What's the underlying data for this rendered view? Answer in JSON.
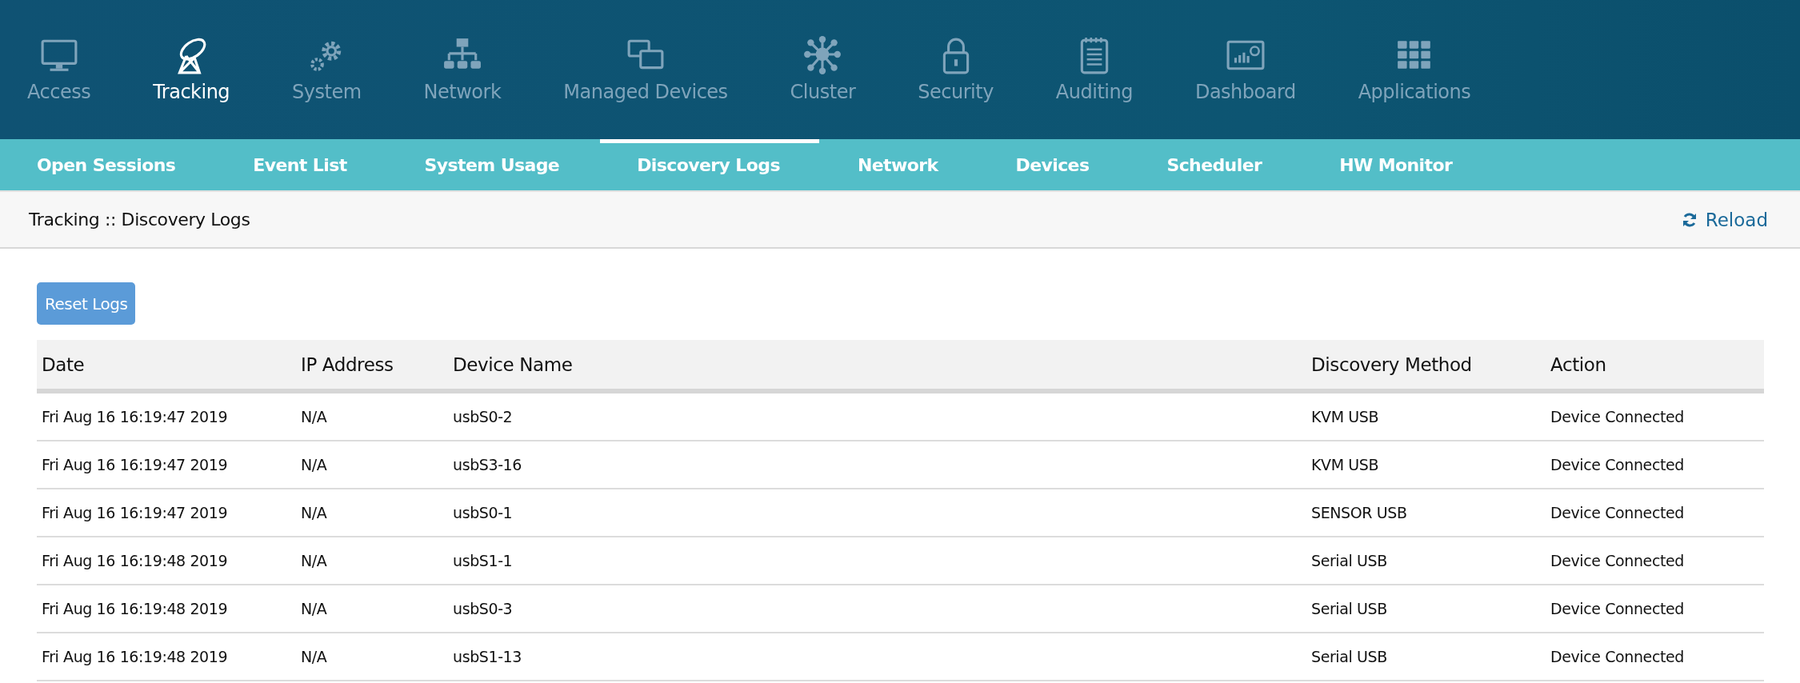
{
  "main_nav": [
    {
      "label": "Access",
      "selected": false
    },
    {
      "label": "Tracking",
      "selected": true
    },
    {
      "label": "System",
      "selected": false
    },
    {
      "label": "Network",
      "selected": false
    },
    {
      "label": "Managed Devices",
      "selected": false
    },
    {
      "label": "Cluster",
      "selected": false
    },
    {
      "label": "Security",
      "selected": false
    },
    {
      "label": "Auditing",
      "selected": false
    },
    {
      "label": "Dashboard",
      "selected": false
    },
    {
      "label": "Applications",
      "selected": false
    }
  ],
  "sub_tabs": [
    {
      "label": "Open Sessions",
      "selected": false
    },
    {
      "label": "Event List",
      "selected": false
    },
    {
      "label": "System Usage",
      "selected": false
    },
    {
      "label": "Discovery Logs",
      "selected": true
    },
    {
      "label": "Network",
      "selected": false
    },
    {
      "label": "Devices",
      "selected": false
    },
    {
      "label": "Scheduler",
      "selected": false
    },
    {
      "label": "HW Monitor",
      "selected": false
    }
  ],
  "breadcrumb": "Tracking :: Discovery Logs",
  "reload_label": "Reload",
  "reset_button": "Reset Logs",
  "table": {
    "columns": [
      "Date",
      "IP Address",
      "Device Name",
      "Discovery Method",
      "Action"
    ],
    "rows": [
      [
        "Fri Aug 16 16:19:47 2019",
        "N/A",
        "usbS0-2",
        "KVM USB",
        "Device Connected"
      ],
      [
        "Fri Aug 16 16:19:47 2019",
        "N/A",
        "usbS3-16",
        "KVM USB",
        "Device Connected"
      ],
      [
        "Fri Aug 16 16:19:47 2019",
        "N/A",
        "usbS0-1",
        "SENSOR USB",
        "Device Connected"
      ],
      [
        "Fri Aug 16 16:19:48 2019",
        "N/A",
        "usbS1-1",
        "Serial USB",
        "Device Connected"
      ],
      [
        "Fri Aug 16 16:19:48 2019",
        "N/A",
        "usbS0-3",
        "Serial USB",
        "Device Connected"
      ],
      [
        "Fri Aug 16 16:19:48 2019",
        "N/A",
        "usbS1-13",
        "Serial USB",
        "Device Connected"
      ]
    ]
  }
}
